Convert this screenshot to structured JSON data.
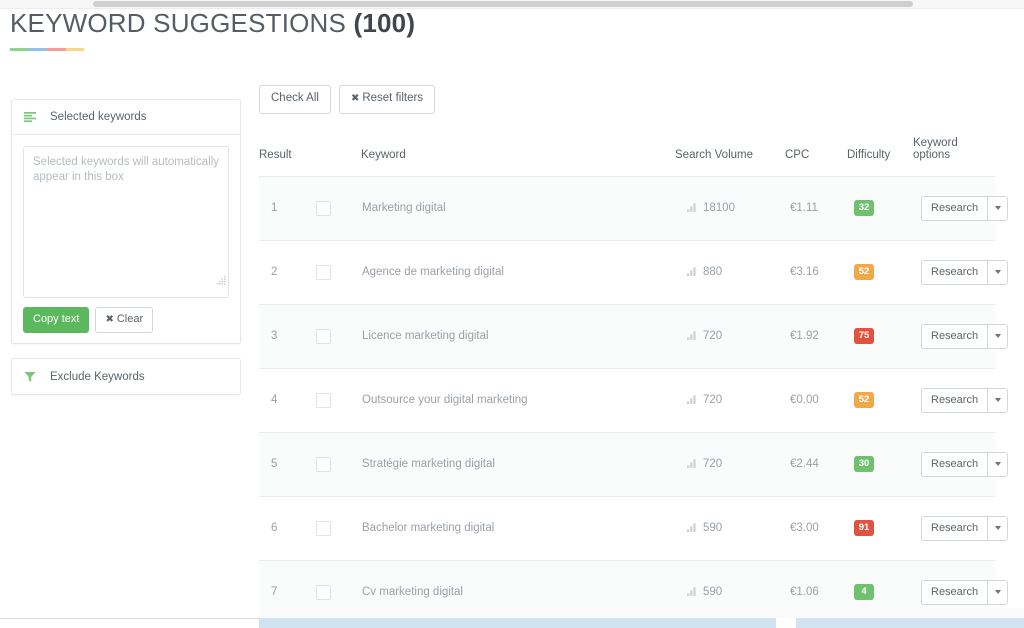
{
  "header": {
    "title": "KEYWORD SUGGESTIONS",
    "count": "(100)",
    "rule_colors": [
      "#8ed48e",
      "#8fc0ef",
      "#f79a9a",
      "#f7d68a"
    ]
  },
  "sidebar": {
    "selected_keywords": {
      "icon": "align-left-icon",
      "title": "Selected keywords",
      "textarea_value": "",
      "textarea_placeholder": "Selected keywords will automatically appear in this box",
      "copy_label": "Copy text",
      "clear_label": "Clear",
      "clear_icon": "✖",
      "copy_color": "#5cb85c"
    },
    "exclude_keywords": {
      "icon": "filter-icon",
      "title": "Exclude Keywords"
    }
  },
  "toolbar": {
    "check_all_label": "Check All",
    "reset_filters_label": "Reset filters",
    "reset_icon": "✖"
  },
  "table": {
    "columns": [
      "Result",
      "Keyword",
      "Search Volume",
      "CPC",
      "Difficulty",
      "Keyword options"
    ],
    "option_button_label": "Research",
    "rows": [
      {
        "result": "1",
        "keyword": "Marketing digital",
        "volume": "18100",
        "cpc": "€1.11",
        "difficulty": "32",
        "difficulty_color": "#6fc16f"
      },
      {
        "result": "2",
        "keyword": "Agence de marketing digital",
        "volume": "880",
        "cpc": "€3.16",
        "difficulty": "52",
        "difficulty_color": "#efa94a"
      },
      {
        "result": "3",
        "keyword": "Licence marketing digital",
        "volume": "720",
        "cpc": "€1.92",
        "difficulty": "75",
        "difficulty_color": "#e15241"
      },
      {
        "result": "4",
        "keyword": "Outsource your digital marketing",
        "volume": "720",
        "cpc": "€0.00",
        "difficulty": "52",
        "difficulty_color": "#efa94a"
      },
      {
        "result": "5",
        "keyword": "Stratégie marketing digital",
        "volume": "720",
        "cpc": "€2.44",
        "difficulty": "30",
        "difficulty_color": "#6fc16f"
      },
      {
        "result": "6",
        "keyword": "Bachelor marketing digital",
        "volume": "590",
        "cpc": "€3.00",
        "difficulty": "91",
        "difficulty_color": "#e15241"
      },
      {
        "result": "7",
        "keyword": "Cv marketing digital",
        "volume": "590",
        "cpc": "€1.06",
        "difficulty": "4",
        "difficulty_color": "#6fc16f"
      }
    ]
  }
}
